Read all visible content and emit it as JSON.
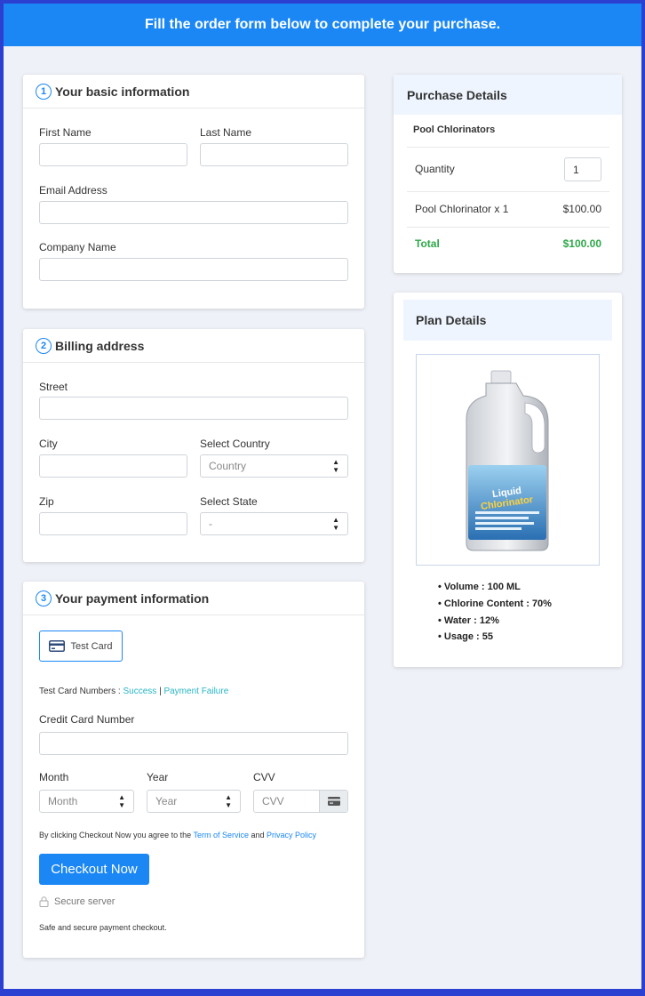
{
  "header": {
    "title": "Fill the order form below to complete your purchase."
  },
  "basic": {
    "step": "1",
    "title": "Your basic information",
    "first_name_label": "First Name",
    "last_name_label": "Last Name",
    "email_label": "Email Address",
    "company_label": "Company Name"
  },
  "billing": {
    "step": "2",
    "title": "Billing address",
    "street_label": "Street",
    "city_label": "City",
    "country_label": "Select Country",
    "country_value": "Country",
    "zip_label": "Zip",
    "state_label": "Select State",
    "state_value": "-"
  },
  "payment": {
    "step": "3",
    "title": "Your payment information",
    "test_card_label": "Test Card",
    "test_numbers_label": "Test Card Numbers :",
    "success_link": "Success",
    "separator": "|",
    "failure_link": "Payment Failure",
    "cc_label": "Credit Card Number",
    "month_label": "Month",
    "month_value": "Month",
    "year_label": "Year",
    "year_value": "Year",
    "cvv_label": "CVV",
    "cvv_placeholder": "CVV",
    "terms_prefix": "By clicking Checkout Now you agree to the",
    "terms_link": "Term of Service",
    "terms_and": "and",
    "privacy_link": "Privacy Policy",
    "checkout_label": "Checkout Now",
    "secure_label": "Secure server",
    "safe_label": "Safe and secure payment checkout."
  },
  "purchase": {
    "title": "Purchase Details",
    "product": "Pool Chlorinators",
    "quantity_label": "Quantity",
    "quantity_value": "1",
    "item_label": "Pool Chlorinator x 1",
    "item_price": "$100.00",
    "total_label": "Total",
    "total_value": "$100.00",
    "total_color": "#2ea84a"
  },
  "plan": {
    "title": "Plan Details",
    "bullets": [
      "Volume : 100 ML",
      "Chlorine Content : 70%",
      "Water : 12%",
      "Usage : 55"
    ]
  },
  "colors": {
    "accent": "#1a87f5",
    "background": "#2b3fd1"
  }
}
